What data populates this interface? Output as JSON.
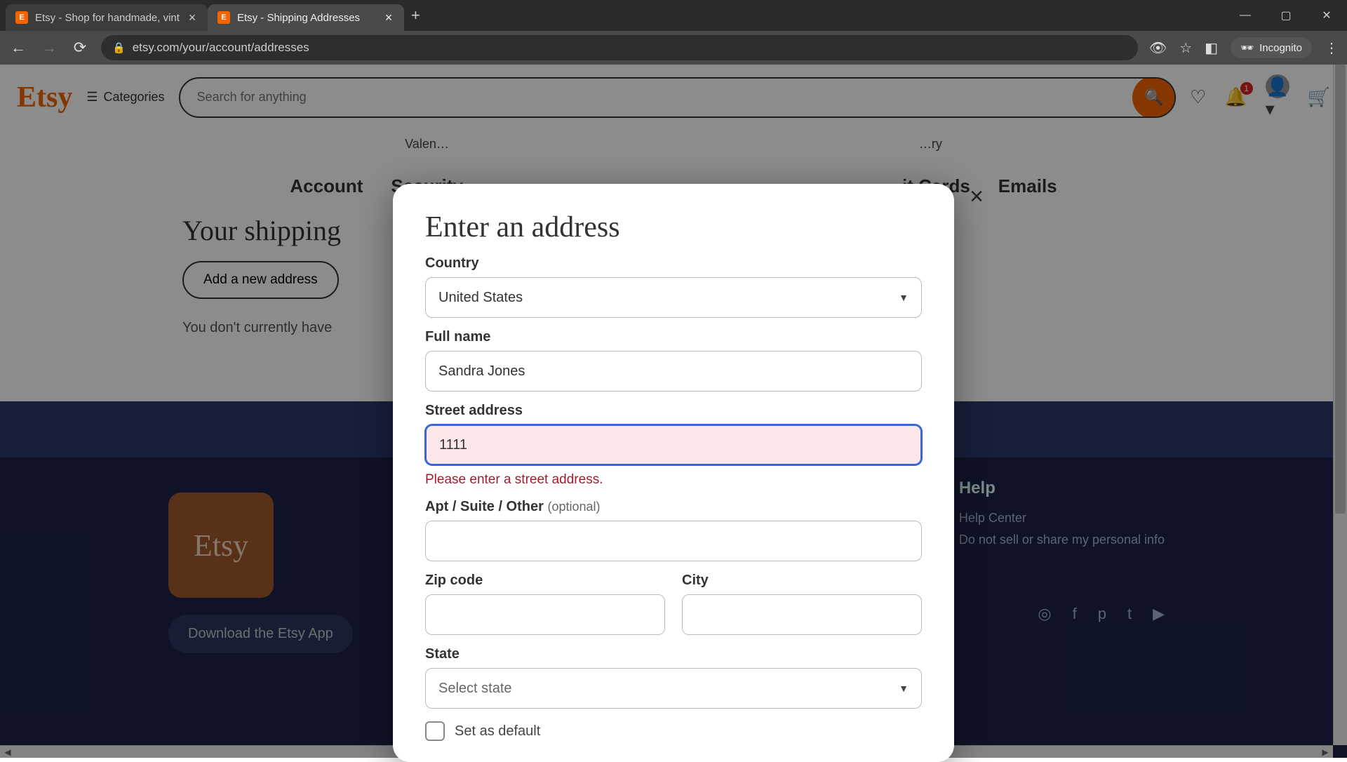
{
  "browser": {
    "tabs": [
      {
        "title": "Etsy - Shop for handmade, vint",
        "active": false
      },
      {
        "title": "Etsy - Shipping Addresses",
        "active": true
      }
    ],
    "url": "etsy.com/your/account/addresses",
    "incognito_label": "Incognito"
  },
  "header": {
    "logo_text": "Etsy",
    "categories_label": "Categories",
    "search_placeholder": "Search for anything",
    "notification_count": "1"
  },
  "sub_nav": {
    "items": [
      "Valen…",
      "…ry"
    ]
  },
  "account_tabs": [
    "Account",
    "Security",
    "…it Cards",
    "Emails"
  ],
  "page": {
    "title": "Your shipping",
    "add_button": "Add a new address",
    "empty_text": "You don't currently have"
  },
  "footer": {
    "app_tile": "Etsy",
    "download_label": "Download the Etsy App",
    "help_heading": "Help",
    "help_links": [
      "Help Center",
      "Do not sell or share my personal info"
    ]
  },
  "modal": {
    "title": "Enter an address",
    "labels": {
      "country": "Country",
      "full_name": "Full name",
      "street": "Street address",
      "apt": "Apt / Suite / Other",
      "apt_optional": "(optional)",
      "zip": "Zip code",
      "city": "City",
      "state": "State",
      "default": "Set as default"
    },
    "values": {
      "country": "United States",
      "full_name": "Sandra Jones",
      "street": "1111",
      "apt": "",
      "zip": "",
      "city": "",
      "state": "Select state",
      "default_checked": false
    },
    "errors": {
      "street": "Please enter a street address."
    }
  }
}
